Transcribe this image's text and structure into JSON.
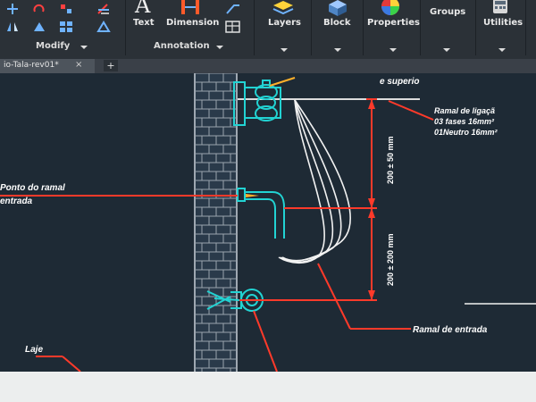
{
  "ribbon": {
    "tools": {
      "text_label": "Text",
      "dimension_label": "Dimension",
      "layers_label": "Layers",
      "block_label": "Block",
      "properties_label": "Properties",
      "groups_label": "Groups",
      "utilities_label": "Utilities"
    },
    "panels": {
      "modify_label": "Modify",
      "annotation_label": "Annotation"
    }
  },
  "tabs": {
    "active_label": "io-Tala-rev01*",
    "close_glyph": "×",
    "new_tab_glyph": "+"
  },
  "drawing": {
    "annotations": {
      "top_superior": "e superio",
      "ramal_ligacao": "Ramal de ligaçã",
      "fases_line": "03 fases 16mm²",
      "neutro_line": "01Neutro 16mm²",
      "ponto_ramal_line1": "Ponto do ramal",
      "ponto_ramal_line2": "entrada",
      "ramal_entrada": "Ramal de entrada",
      "laje": "Laje",
      "dim_upper": "200 ± 50 mm",
      "dim_lower": "200 ± 200 mm"
    },
    "colors": {
      "background": "#1e2a35",
      "cyan": "#22d3d3",
      "red": "#ff3a2a",
      "white": "#f2f2f2",
      "brick": "#9aa4ad"
    }
  }
}
